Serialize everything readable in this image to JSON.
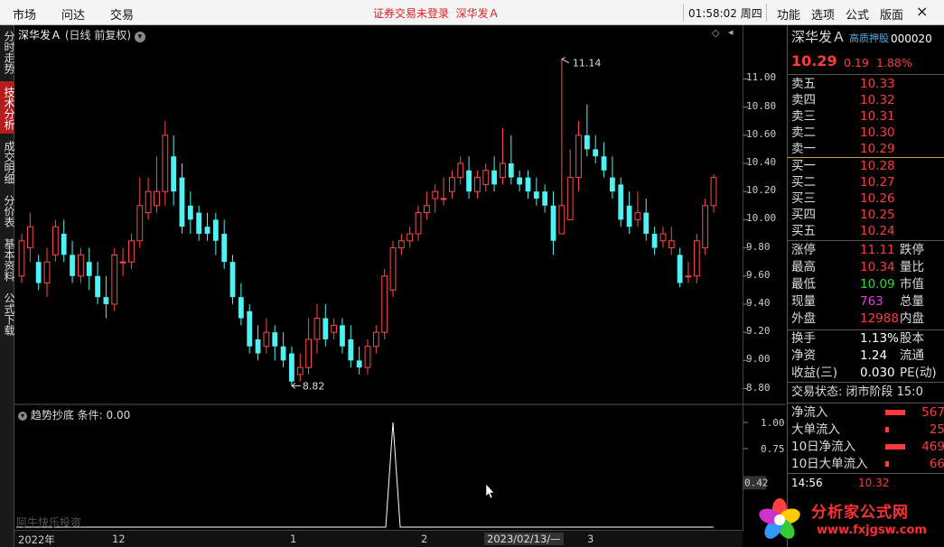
{
  "topbar": {
    "menu": [
      "市场",
      "问达",
      "交易"
    ],
    "login_warning": "证券交易未登录",
    "stock_link": "深华发Ａ",
    "clock": "01:58:02 周四",
    "right_menu": [
      "功能",
      "选项",
      "公式",
      "版面"
    ],
    "close": "×"
  },
  "left_tabs": [
    "分时走势",
    "技术分析",
    "成交明细",
    "分价表",
    "基本资料",
    "公式下载"
  ],
  "chart_header": {
    "name": "深华发Ａ",
    "mode": "(日线 前复权)"
  },
  "indicator_header": "趋势抄底 条件: 0.00",
  "watermark": "阿牛快乐投资",
  "price_axis": [
    "11.00",
    "10.80",
    "10.60",
    "10.40",
    "10.20",
    "10.00",
    "9.80",
    "9.60",
    "9.40",
    "9.20",
    "9.00",
    "8.80"
  ],
  "ind_axis": [
    "1.00",
    "0.75",
    "0.42"
  ],
  "annotations": {
    "high": "11.14",
    "low": "8.82"
  },
  "x_axis": {
    "labels": [
      "2022年",
      "12",
      "1",
      "2",
      "2023/02/13/—",
      "3"
    ]
  },
  "chart_data": {
    "type": "candlestick",
    "ylim": [
      8.72,
      11.24
    ],
    "candles": [
      [
        9.6,
        9.85,
        9.55,
        9.9
      ],
      [
        9.8,
        9.95,
        9.7,
        10.05
      ],
      [
        9.7,
        9.55,
        9.5,
        9.75
      ],
      [
        9.55,
        9.7,
        9.45,
        9.8
      ],
      [
        9.75,
        9.95,
        9.7,
        10.0
      ],
      [
        9.9,
        9.75,
        9.7,
        10.0
      ],
      [
        9.75,
        9.6,
        9.55,
        9.85
      ],
      [
        9.6,
        9.75,
        9.55,
        9.8
      ],
      [
        9.7,
        9.6,
        9.5,
        9.8
      ],
      [
        9.6,
        9.45,
        9.4,
        9.7
      ],
      [
        9.45,
        9.4,
        9.3,
        9.6
      ],
      [
        9.4,
        9.75,
        9.35,
        9.8
      ],
      [
        9.7,
        9.7,
        9.6,
        9.8
      ],
      [
        9.7,
        9.85,
        9.65,
        9.9
      ],
      [
        9.85,
        10.1,
        9.8,
        10.3
      ],
      [
        10.05,
        10.2,
        10.0,
        10.3
      ],
      [
        10.1,
        10.2,
        10.05,
        10.45
      ],
      [
        10.2,
        10.6,
        10.1,
        10.7
      ],
      [
        10.45,
        10.2,
        10.1,
        10.6
      ],
      [
        10.3,
        9.95,
        9.9,
        10.4
      ],
      [
        10.1,
        10.0,
        9.9,
        10.2
      ],
      [
        10.05,
        9.9,
        9.85,
        10.1
      ],
      [
        9.95,
        9.9,
        9.85,
        10.05
      ],
      [
        10.0,
        9.85,
        9.75,
        10.05
      ],
      [
        9.9,
        9.7,
        9.65,
        10.0
      ],
      [
        9.7,
        9.45,
        9.4,
        9.75
      ],
      [
        9.45,
        9.3,
        9.25,
        9.55
      ],
      [
        9.35,
        9.1,
        9.05,
        9.4
      ],
      [
        9.15,
        9.05,
        9.0,
        9.25
      ],
      [
        9.1,
        9.2,
        9.05,
        9.3
      ],
      [
        9.2,
        9.1,
        9.0,
        9.25
      ],
      [
        9.1,
        9.0,
        8.95,
        9.2
      ],
      [
        9.05,
        8.85,
        8.82,
        9.1
      ],
      [
        8.9,
        8.95,
        8.85,
        9.05
      ],
      [
        8.95,
        9.15,
        8.9,
        9.3
      ],
      [
        9.15,
        9.3,
        9.05,
        9.4
      ],
      [
        9.3,
        9.15,
        9.1,
        9.4
      ],
      [
        9.2,
        9.25,
        9.15,
        9.3
      ],
      [
        9.25,
        9.1,
        9.05,
        9.3
      ],
      [
        9.15,
        9.0,
        8.95,
        9.25
      ],
      [
        9.0,
        8.95,
        8.9,
        9.1
      ],
      [
        8.95,
        9.1,
        8.9,
        9.15
      ],
      [
        9.1,
        9.2,
        9.05,
        9.25
      ],
      [
        9.2,
        9.6,
        9.15,
        9.65
      ],
      [
        9.5,
        9.8,
        9.45,
        9.85
      ],
      [
        9.8,
        9.85,
        9.75,
        9.9
      ],
      [
        9.85,
        9.9,
        9.8,
        9.95
      ],
      [
        9.9,
        10.05,
        9.85,
        10.1
      ],
      [
        10.05,
        10.1,
        10.0,
        10.2
      ],
      [
        10.15,
        10.2,
        10.05,
        10.25
      ],
      [
        10.15,
        10.15,
        10.1,
        10.3
      ],
      [
        10.2,
        10.3,
        10.15,
        10.35
      ],
      [
        10.3,
        10.4,
        10.25,
        10.45
      ],
      [
        10.35,
        10.2,
        10.15,
        10.45
      ],
      [
        10.2,
        10.3,
        10.15,
        10.35
      ],
      [
        10.25,
        10.35,
        10.2,
        10.4
      ],
      [
        10.35,
        10.25,
        10.2,
        10.45
      ],
      [
        10.3,
        10.4,
        10.25,
        10.65
      ],
      [
        10.4,
        10.3,
        10.25,
        10.6
      ],
      [
        10.3,
        10.25,
        10.2,
        10.35
      ],
      [
        10.3,
        10.2,
        10.15,
        10.35
      ],
      [
        10.2,
        10.15,
        10.1,
        10.3
      ],
      [
        10.2,
        10.1,
        10.05,
        10.25
      ],
      [
        10.1,
        9.85,
        9.75,
        10.2
      ],
      [
        9.9,
        10.1,
        9.9,
        11.14
      ],
      [
        10.0,
        10.3,
        10.0,
        10.5
      ],
      [
        10.3,
        10.6,
        10.2,
        10.7
      ],
      [
        10.6,
        10.5,
        10.45,
        10.82
      ],
      [
        10.5,
        10.45,
        10.4,
        10.6
      ],
      [
        10.45,
        10.35,
        10.3,
        10.55
      ],
      [
        10.3,
        10.2,
        10.15,
        10.45
      ],
      [
        10.25,
        10.0,
        9.95,
        10.3
      ],
      [
        10.1,
        9.95,
        9.9,
        10.2
      ],
      [
        10.0,
        10.05,
        9.95,
        10.2
      ],
      [
        10.05,
        9.9,
        9.85,
        10.15
      ],
      [
        9.9,
        9.8,
        9.75,
        9.95
      ],
      [
        9.85,
        9.9,
        9.8,
        9.95
      ],
      [
        9.8,
        9.85,
        9.75,
        9.95
      ],
      [
        9.75,
        9.55,
        9.52,
        9.8
      ],
      [
        9.6,
        9.6,
        9.55,
        9.7
      ],
      [
        9.6,
        9.85,
        9.55,
        9.9
      ],
      [
        9.8,
        10.1,
        9.75,
        10.15
      ],
      [
        10.1,
        10.3,
        10.05,
        10.32
      ]
    ]
  },
  "indicator_data": {
    "type": "line",
    "values_peak_index": 44,
    "peak": 1.0
  },
  "quote": {
    "title": "深华发Ａ",
    "tag": "高质押股",
    "code": "000020",
    "price": "10.29",
    "change": "0.19",
    "pct": "1.88%",
    "sell": [
      [
        "卖五",
        "10.33"
      ],
      [
        "卖四",
        "10.32"
      ],
      [
        "卖三",
        "10.31"
      ],
      [
        "卖二",
        "10.30"
      ],
      [
        "卖一",
        "10.29"
      ]
    ],
    "buy": [
      [
        "买一",
        "10.28"
      ],
      [
        "买二",
        "10.27"
      ],
      [
        "买三",
        "10.26"
      ],
      [
        "买四",
        "10.25"
      ],
      [
        "买五",
        "10.24"
      ]
    ],
    "stats": [
      [
        "涨停",
        "11.11",
        "red",
        "跌停"
      ],
      [
        "最高",
        "10.34",
        "red",
        "量比"
      ],
      [
        "最低",
        "10.09",
        "green",
        "市值"
      ],
      [
        "现量",
        "763",
        "purple",
        "总量"
      ],
      [
        "外盘",
        "12988",
        "red",
        "内盘"
      ]
    ],
    "stats2": [
      [
        "换手",
        "1.13%",
        "股本"
      ],
      [
        "净资",
        "1.24",
        "流通"
      ],
      [
        "收益(三)",
        "0.030",
        "PE(动)"
      ]
    ],
    "state": "交易状态: 闭市阶段 15:0",
    "flows": [
      [
        "净流入",
        "567"
      ],
      [
        "大单流入",
        "25"
      ],
      [
        "10日净流入",
        "469"
      ],
      [
        "10日大单流入",
        "66"
      ]
    ],
    "tick_time": "14:56",
    "tick_price": "10.32"
  },
  "logo": {
    "text": "分析家公式网",
    "url": "www.fxjgsw.com"
  }
}
